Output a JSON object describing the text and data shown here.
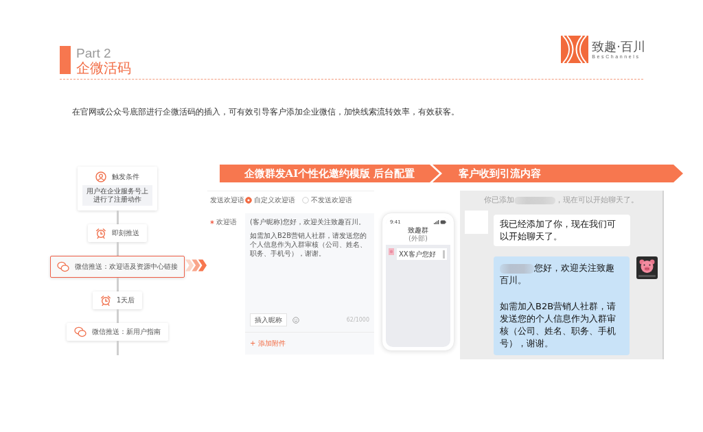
{
  "header": {
    "part": "Part 2",
    "title": "企微活码"
  },
  "logo": {
    "name": "致趣·百川",
    "subtitle": "BesChannels"
  },
  "description": "在官网或公众号底部进行企微活码的插入，可有效引导客户添加企业微信，加快线索流转效率，有效获客。",
  "flow": {
    "steps": [
      {
        "kind": "trigger",
        "title": "触发条件",
        "detail": "用户在企业服务号上进行了注册动作",
        "selected": false
      },
      {
        "kind": "timer",
        "title": "即刻推送",
        "selected": false
      },
      {
        "kind": "message",
        "title": "微信推送：欢迎语及资源中心链接",
        "selected": true
      },
      {
        "kind": "timer",
        "title": "1天后",
        "selected": false
      },
      {
        "kind": "message",
        "title": "微信推送：新用户指南",
        "selected": false
      }
    ]
  },
  "banner": {
    "steps": [
      "企微群发AI个性化邀约模版 后台配置",
      "客户收到引流内容"
    ]
  },
  "config": {
    "mode_label": "发送欢迎语",
    "options": [
      {
        "label": "自定义欢迎语",
        "selected": true
      },
      {
        "label": "不发送欢迎语",
        "selected": false
      }
    ],
    "message_label": "欢迎语",
    "required": true,
    "message": [
      "(客户昵称)您好，欢迎关注致趣百川。",
      "如需加入B2B营销人社群，请发送您的个人信息作为入群审核（公司、姓名、职务、手机号），谢谢。"
    ],
    "insert_button": "插入昵称",
    "counter": "62/1000",
    "add_attachment": "+ 添加附件"
  },
  "phone": {
    "time": "9:41",
    "title": "致趣群",
    "subtitle": "(外部)",
    "message": "XX客户您好"
  },
  "chat": {
    "system_before": "你已添加",
    "system_redacted": true,
    "system_after": "，现在可以开始聊天了。",
    "messages": [
      {
        "kind": "incoming",
        "blurred_prefix": false,
        "paragraphs": [
          "我已经添加了你，现在我们可以开始聊天了。"
        ]
      },
      {
        "kind": "outgoing",
        "blurred_prefix": true,
        "paragraphs": [
          "您好，欢迎关注致趣百川。",
          "如需加入B2B营销人社群，请发送您的个人信息作为入群审核（公司、姓名、职务、手机号），谢谢。"
        ]
      }
    ]
  }
}
